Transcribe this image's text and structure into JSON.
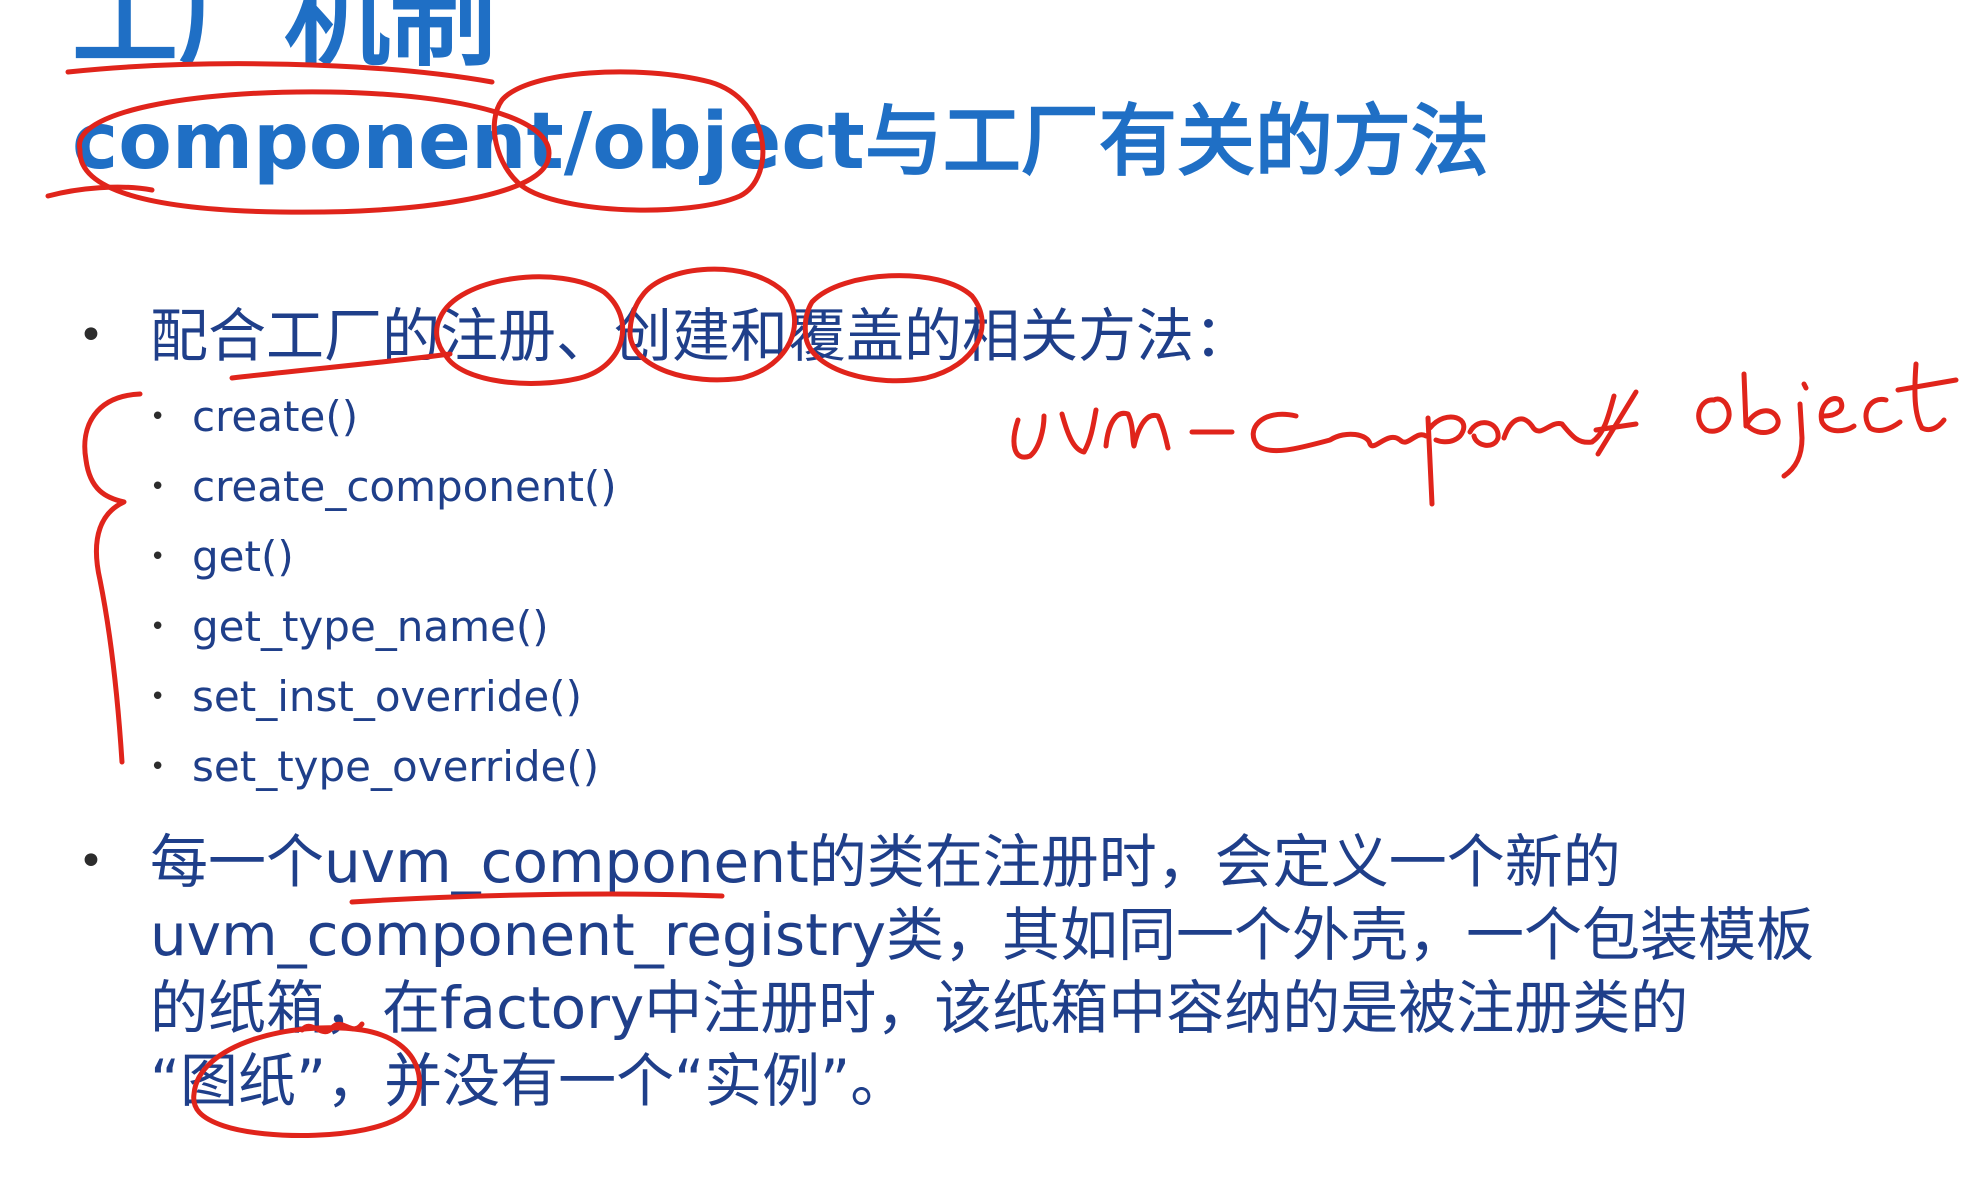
{
  "slide": {
    "title": "工厂机制",
    "subtitle": "component/object与工厂有关的方法",
    "bullet1": {
      "text": "配合工厂的注册、创建和覆盖的相关方法：",
      "methods": [
        "create()",
        "create_component()",
        "get()",
        "get_type_name()",
        "set_inst_override()",
        "set_type_override()"
      ]
    },
    "bullet2": {
      "text": "每一个uvm_component的类在注册时，会定义一个新的\nuvm_component_registry类，其如同一个外壳，一个包装模板\n的纸箱，在factory中注册时，该纸箱中容纳的是被注册类的\n“图纸”，并没有一个“实例”。"
    }
  },
  "colors": {
    "title": "#1f6fc5",
    "body": "#1f3f8a",
    "ink": "#e0241b"
  }
}
